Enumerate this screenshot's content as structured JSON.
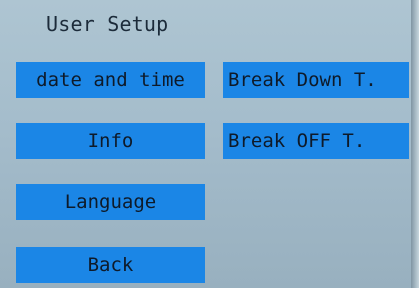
{
  "screen": {
    "title": "User Setup",
    "left_buttons": [
      {
        "label": "date and time"
      },
      {
        "label": "Info"
      },
      {
        "label": "Language"
      },
      {
        "label": "Back"
      }
    ],
    "right_buttons": [
      {
        "label": "Break Down T."
      },
      {
        "label": "Break OFF T."
      }
    ]
  },
  "colors": {
    "background": "#a4bccb",
    "button": "#1b86e6",
    "text": "#0e1a29"
  }
}
